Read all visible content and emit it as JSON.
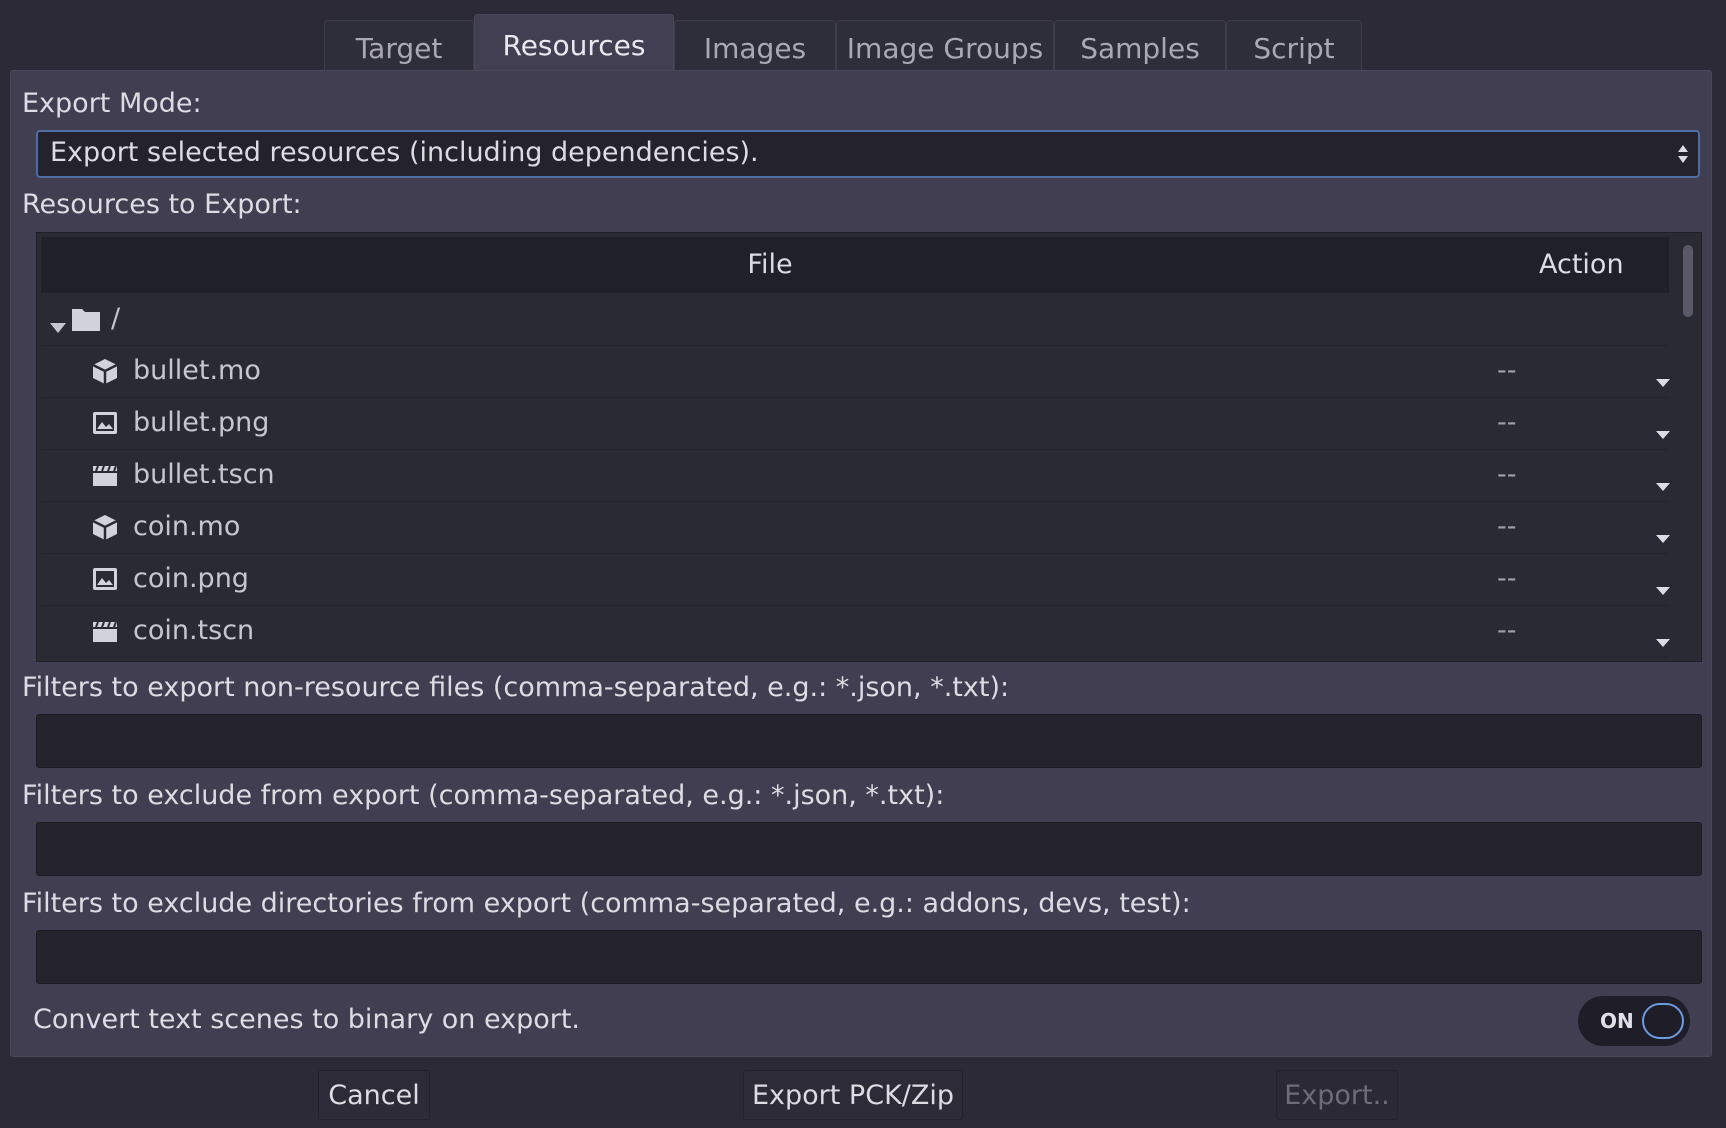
{
  "tabs": [
    "Target",
    "Resources",
    "Images",
    "Image Groups",
    "Samples",
    "Script"
  ],
  "active_tab": "Resources",
  "export_mode": {
    "label": "Export Mode:",
    "value": "Export selected resources (including dependencies)."
  },
  "resources": {
    "label": "Resources to Export:",
    "columns": {
      "file": "File",
      "action": "Action"
    },
    "root": "/",
    "items": [
      {
        "name": "bullet.mo",
        "icon": "mesh-icon",
        "action": "--"
      },
      {
        "name": "bullet.png",
        "icon": "image-icon",
        "action": "--"
      },
      {
        "name": "bullet.tscn",
        "icon": "scene-icon",
        "action": "--"
      },
      {
        "name": "coin.mo",
        "icon": "mesh-icon",
        "action": "--"
      },
      {
        "name": "coin.png",
        "icon": "image-icon",
        "action": "--"
      },
      {
        "name": "coin.tscn",
        "icon": "scene-icon",
        "action": "--"
      }
    ]
  },
  "filters": {
    "non_resource_label": "Filters to export non-resource files (comma-separated, e.g.: *.json, *.txt):",
    "non_resource_value": "",
    "exclude_label": "Filters to exclude from export (comma-separated, e.g.: *.json, *.txt):",
    "exclude_value": "",
    "exclude_dirs_label": "Filters to exclude directories from export (comma-separated, e.g.: addons, devs, test):",
    "exclude_dirs_value": ""
  },
  "convert_binary": {
    "label": "Convert text scenes to binary on export.",
    "state": "ON"
  },
  "buttons": {
    "cancel": "Cancel",
    "export_pck": "Export PCK/Zip",
    "export": "Export.."
  },
  "colors": {
    "background": "#2b2a36",
    "panel": "#403e50",
    "accent": "#6d9be0"
  }
}
